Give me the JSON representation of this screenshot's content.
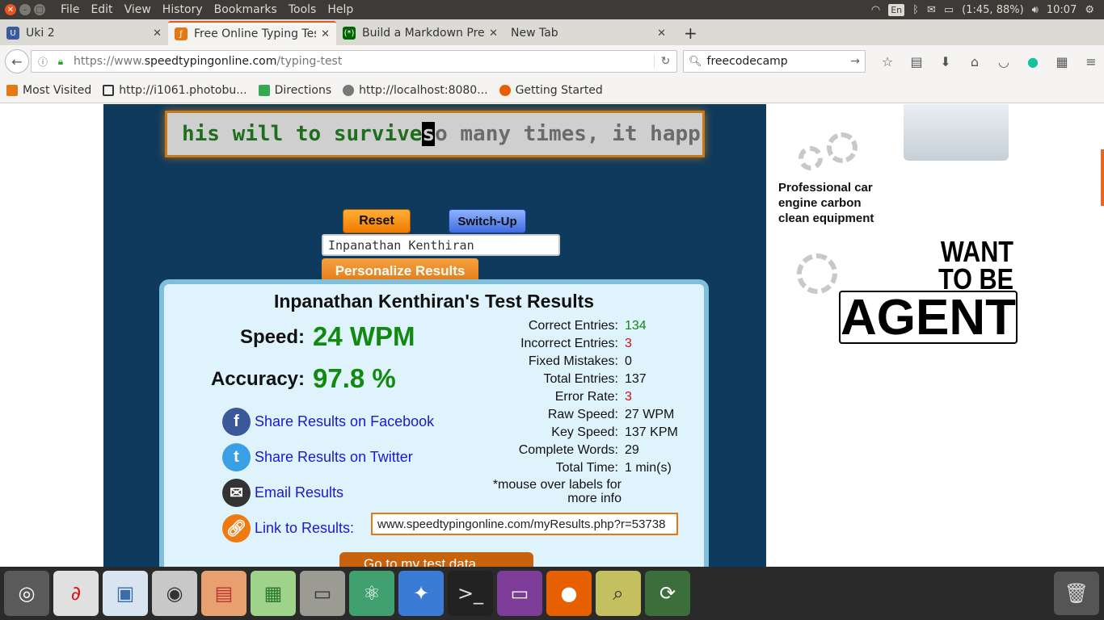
{
  "menubar": {
    "menus": [
      "File",
      "Edit",
      "View",
      "History",
      "Bookmarks",
      "Tools",
      "Help"
    ],
    "tray": {
      "lang": "En",
      "battery": "(1:45, 88%)",
      "clock": "10:07"
    }
  },
  "tabs": [
    {
      "label": "Uki 2",
      "icon": "uki-favicon"
    },
    {
      "label": "Free Online Typing Test",
      "icon": "speedtyping-favicon"
    },
    {
      "label": "Build a Markdown Previewer",
      "icon": "freecodecamp-favicon"
    },
    {
      "label": "New Tab",
      "icon": ""
    }
  ],
  "nav": {
    "url_prefix": "https://www.",
    "url_domain": "speedtypingonline.com",
    "url_path": "/typing-test",
    "search_value": "freecodecamp"
  },
  "bookmarks": [
    "Most Visited",
    "http://i1061.photobu...",
    "Directions",
    "http://localhost:8080...",
    "Getting Started"
  ],
  "typing": {
    "typed": "his will to survive ",
    "cursor": "s",
    "remaining": "o many times, it happ"
  },
  "controls": {
    "reset": "Reset",
    "switch": "Switch-Up",
    "name_value": "Inpanathan Kenthiran",
    "personalize": "Personalize Results"
  },
  "results": {
    "title": "Inpanathan Kenthiran's Test Results",
    "speed_label": "Speed:",
    "speed_value": "24 WPM",
    "accuracy_label": "Accuracy:",
    "accuracy_value": "97.8 %",
    "stats": [
      {
        "label": "Correct Entries:",
        "value": "134",
        "color": "green"
      },
      {
        "label": "Incorrect Entries:",
        "value": "3",
        "color": "red"
      },
      {
        "label": "Fixed Mistakes:",
        "value": "0",
        "color": ""
      },
      {
        "label": "Total Entries:",
        "value": "137",
        "color": ""
      },
      {
        "label": "Error Rate:",
        "value": "3",
        "color": "red"
      },
      {
        "label": "Raw Speed:",
        "value": "27 WPM",
        "color": ""
      },
      {
        "label": "Key Speed:",
        "value": "137 KPM",
        "color": ""
      },
      {
        "label": "Complete Words:",
        "value": "29",
        "color": ""
      },
      {
        "label": "Total Time:",
        "value": "1 min(s)",
        "color": ""
      }
    ],
    "mouse_note": "*mouse over labels for more info",
    "share_facebook": "Share Results on Facebook",
    "share_twitter": "Share Results on Twitter",
    "email": "Email Results",
    "link_label": "Link to Results:",
    "link_value": "www.speedtypingonline.com/myResults.php?r=53738",
    "go_test": "Go to my test data"
  },
  "ad": {
    "text": "Professional car engine carbon clean equipment",
    "want": "WANT TO BE",
    "agent": "AGENT"
  }
}
